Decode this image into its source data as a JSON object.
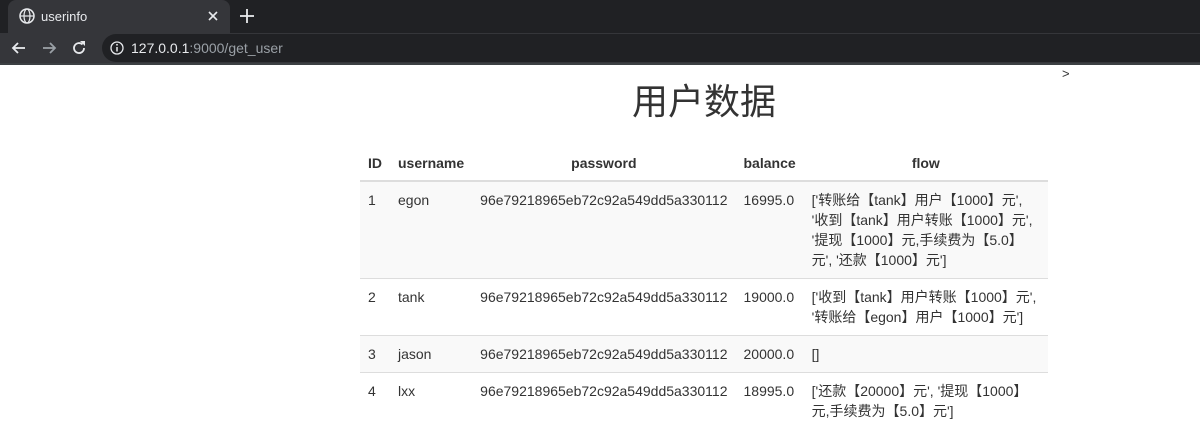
{
  "browser": {
    "tab_title": "userinfo",
    "url_host": "127.0.0.1",
    "url_rest": ":9000/get_user",
    "icons": [
      "globe-icon",
      "close-icon",
      "plus-icon",
      "back-arrow-icon",
      "forward-arrow-icon",
      "reload-icon",
      "info-icon"
    ]
  },
  "page": {
    "stray_text": ">",
    "title": "用户数据"
  },
  "table": {
    "headers": {
      "id": "ID",
      "username": "username",
      "password": "password",
      "balance": "balance",
      "flow": "flow"
    },
    "rows": [
      {
        "id": "1",
        "username": "egon",
        "password": "96e79218965eb72c92a549dd5a330112",
        "balance": "16995.0",
        "flow": "['转账给【tank】用户【1000】元', '收到【tank】用户转账【1000】元', '提现【1000】元,手续费为【5.0】元', '还款【1000】元']"
      },
      {
        "id": "2",
        "username": "tank",
        "password": "96e79218965eb72c92a549dd5a330112",
        "balance": "19000.0",
        "flow": "['收到【tank】用户转账【1000】元', '转账给【egon】用户【1000】元']"
      },
      {
        "id": "3",
        "username": "jason",
        "password": "96e79218965eb72c92a549dd5a330112",
        "balance": "20000.0",
        "flow": "[]"
      },
      {
        "id": "4",
        "username": "lxx",
        "password": "96e79218965eb72c92a549dd5a330112",
        "balance": "18995.0",
        "flow": "['还款【20000】元', '提现【1000】元,手续费为【5.0】元']"
      }
    ]
  }
}
